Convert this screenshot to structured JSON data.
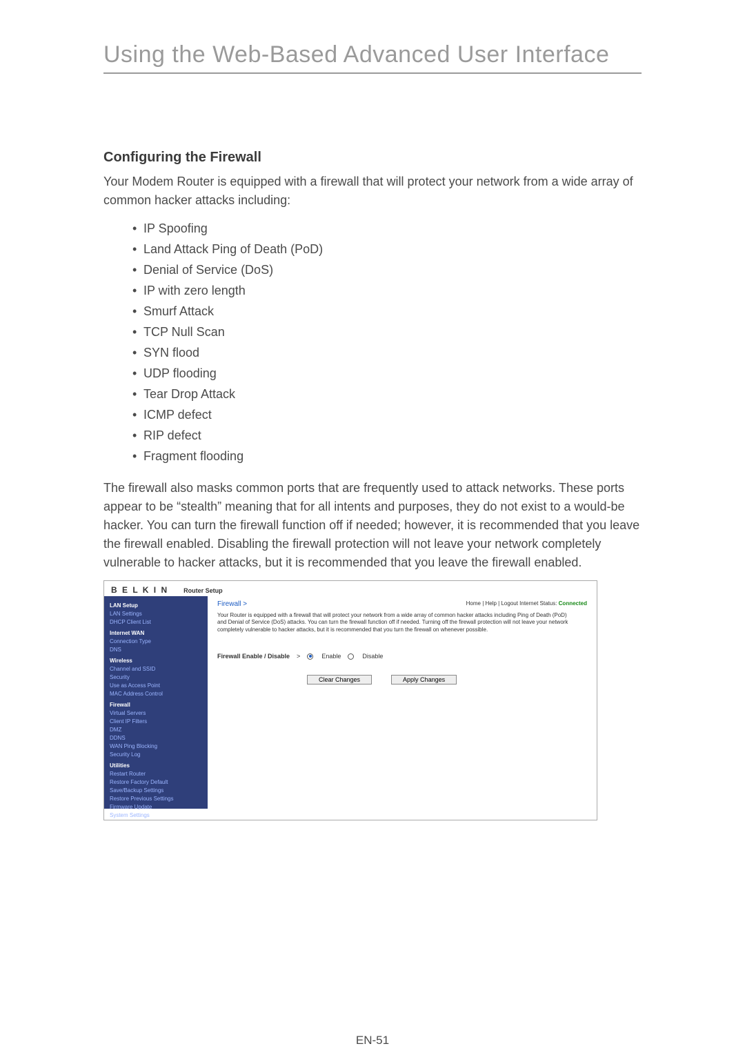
{
  "page": {
    "title": "Using the Web-Based Advanced User Interface",
    "section_heading": "Configuring the Firewall",
    "intro": "Your Modem Router is equipped with a firewall that will protect your network from a wide array of common hacker attacks including:",
    "attacks": [
      "IP Spoofing",
      "Land Attack Ping of Death (PoD)",
      "Denial of Service (DoS)",
      "IP with zero length",
      "Smurf Attack",
      "TCP Null Scan",
      "SYN flood",
      "UDP flooding",
      "Tear Drop Attack",
      "ICMP defect",
      "RIP defect",
      "Fragment flooding"
    ],
    "closing": "The firewall also masks common ports that are frequently used to attack networks. These ports appear to be “stealth” meaning that for all intents and purposes, they do not exist to a would-be hacker. You can turn the firewall function off if needed; however, it is recommended that you leave the firewall enabled. Disabling the firewall protection will not leave your network completely vulnerable to hacker attacks, but it is recommended that you leave the firewall enabled.",
    "page_number": "EN-51"
  },
  "router": {
    "brand": "B E L K I N",
    "section_label": "Router Setup",
    "top_links": "Home | Help | Logout   Internet Status:",
    "status_value": "Connected",
    "crumb_label": "Firewall",
    "crumb_sep": ">",
    "desc": "Your Router is equipped with a firewall that will protect your network from a wide array of common hacker attacks including Ping of Death (PoD) and Denial of Service (DoS) attacks. You can turn the firewall function off if needed. Turning off the firewall protection will not leave your network completely vulnerable to hacker attacks, but it is recommended that you turn the firewall on whenever possible.",
    "toggle_label": "Firewall Enable / Disable",
    "toggle_sep": ">",
    "enable_label": "Enable",
    "disable_label": "Disable",
    "clear_btn": "Clear Changes",
    "apply_btn": "Apply Changes",
    "sidebar": [
      {
        "text": "LAN Setup",
        "hd": true
      },
      {
        "text": "LAN Settings"
      },
      {
        "text": "DHCP Client List"
      },
      {
        "text": "Internet WAN",
        "hd": true
      },
      {
        "text": "Connection Type"
      },
      {
        "text": "DNS"
      },
      {
        "text": "Wireless",
        "hd": true
      },
      {
        "text": "Channel and SSID"
      },
      {
        "text": "Security"
      },
      {
        "text": "Use as Access Point"
      },
      {
        "text": "MAC Address Control"
      },
      {
        "text": "Firewall",
        "hd": true
      },
      {
        "text": "Virtual Servers"
      },
      {
        "text": "Client IP Filters"
      },
      {
        "text": "DMZ"
      },
      {
        "text": "DDNS"
      },
      {
        "text": "WAN Ping Blocking"
      },
      {
        "text": "Security Log"
      },
      {
        "text": "Utilities",
        "hd": true
      },
      {
        "text": "Restart Router"
      },
      {
        "text": "Restore Factory Default"
      },
      {
        "text": "Save/Backup Settings"
      },
      {
        "text": "Restore Previous Settings"
      },
      {
        "text": "Firmware Update"
      },
      {
        "text": "System Settings"
      }
    ]
  }
}
